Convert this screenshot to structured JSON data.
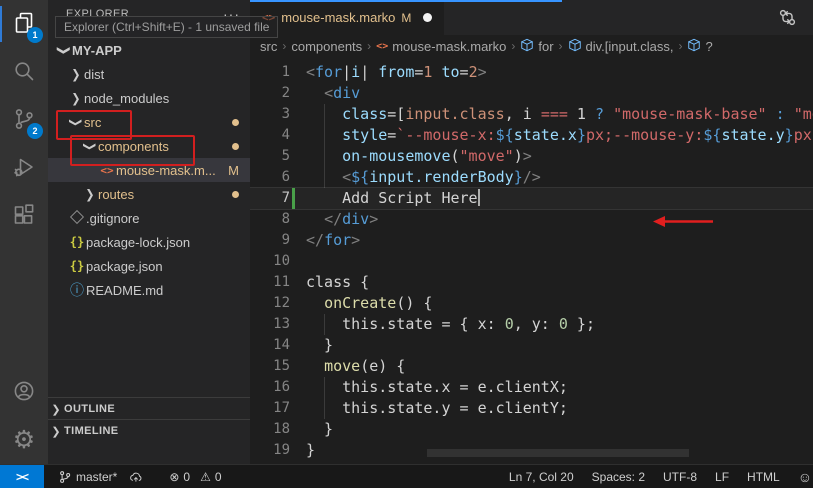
{
  "colors": {
    "accent_blue": "#007acc",
    "activity_badge_blue": "#007acc",
    "modified_tan": "#e2c08d",
    "marko_orange": "#e8744c",
    "annotation_red": "#d21f1f",
    "keyword_blue": "#569cd6",
    "variable_light_blue": "#9cdcfe",
    "string_red": "#d16969",
    "remote_blue": "#0078d4",
    "added_line_green": "#49a049"
  },
  "activity_bar": {
    "items": [
      {
        "name": "explorer",
        "icon": "files-icon",
        "badge": "1",
        "active": true
      },
      {
        "name": "search",
        "icon": "search-icon"
      },
      {
        "name": "source-control",
        "icon": "source-control-icon",
        "badge": "2"
      },
      {
        "name": "run-debug",
        "icon": "run-debug-icon"
      },
      {
        "name": "extensions",
        "icon": "extensions-icon"
      }
    ],
    "bottom_items": [
      {
        "name": "account",
        "icon": "account-icon"
      },
      {
        "name": "settings",
        "icon": "gear-icon"
      }
    ]
  },
  "sidebar": {
    "title": "EXPLORER",
    "more_actions": "···",
    "tooltip": "Explorer (Ctrl+Shift+E) - 1 unsaved file",
    "root_label": "MY-APP",
    "tree": [
      {
        "label": "dist",
        "kind": "folder",
        "expanded": false,
        "level": 1
      },
      {
        "label": "node_modules",
        "kind": "folder",
        "expanded": false,
        "level": 1
      },
      {
        "label": "src",
        "kind": "folder",
        "expanded": true,
        "level": 1,
        "modified": true,
        "dot": true,
        "annotated": true
      },
      {
        "label": "components",
        "kind": "folder",
        "expanded": true,
        "level": 2,
        "modified": true,
        "dot": true,
        "annotated": true
      },
      {
        "label": "mouse-mask.m...",
        "kind": "marko-file",
        "level": 3,
        "selected": true,
        "modified": true,
        "badge": "M"
      },
      {
        "label": "routes",
        "kind": "folder",
        "expanded": false,
        "level": 2,
        "modified": true,
        "dot": true
      },
      {
        "label": ".gitignore",
        "kind": "git-file",
        "level": 1
      },
      {
        "label": "package-lock.json",
        "kind": "json-file",
        "level": 1
      },
      {
        "label": "package.json",
        "kind": "json-file",
        "level": 1
      },
      {
        "label": "README.md",
        "kind": "info-file",
        "level": 1
      }
    ],
    "sections": [
      "OUTLINE",
      "TIMELINE"
    ]
  },
  "editor": {
    "tab": {
      "label": "mouse-mask.marko",
      "badge": "M",
      "dirty": true
    },
    "breadcrumbs": [
      {
        "label": "src"
      },
      {
        "label": "components"
      },
      {
        "label": "mouse-mask.marko",
        "icon": "marko"
      },
      {
        "label": "for",
        "icon": "symbol"
      },
      {
        "label": "div.[input.class,",
        "icon": "symbol"
      },
      {
        "label": "?",
        "icon": "symbol"
      }
    ],
    "cursor": {
      "line": 7,
      "col": 20
    },
    "annotation": {
      "arrow_line": 7,
      "boxes": [
        "src",
        "components"
      ]
    },
    "lines": [
      {
        "n": 1,
        "segs": [
          [
            "<",
            "p"
          ],
          [
            "for",
            "b"
          ],
          [
            "|",
            "w"
          ],
          [
            "i",
            "lb"
          ],
          [
            "|",
            "w"
          ],
          [
            " ",
            "w"
          ],
          [
            "from",
            "lb"
          ],
          [
            "=",
            "w"
          ],
          [
            "1",
            "t"
          ],
          [
            " ",
            "w"
          ],
          [
            "to",
            "lb"
          ],
          [
            "=",
            "w"
          ],
          [
            "2",
            "t"
          ],
          [
            ">",
            "p"
          ]
        ]
      },
      {
        "n": 2,
        "segs": [
          [
            "  ",
            "w"
          ],
          [
            "<",
            "p"
          ],
          [
            "div",
            "b"
          ]
        ]
      },
      {
        "n": 3,
        "g": [
          1
        ],
        "segs": [
          [
            "    ",
            "w"
          ],
          [
            "class",
            "lb"
          ],
          [
            "=[",
            "w"
          ],
          [
            "input.class",
            "t"
          ],
          [
            ", i ",
            "w"
          ],
          [
            "===",
            "s"
          ],
          [
            " 1 ",
            "w"
          ],
          [
            "?",
            "b"
          ],
          [
            " ",
            "w"
          ],
          [
            "\"mouse-mask-base\"",
            "s"
          ],
          [
            " ",
            "w"
          ],
          [
            ":",
            "b"
          ],
          [
            " ",
            "w"
          ],
          [
            "\"mou",
            "s"
          ]
        ]
      },
      {
        "n": 4,
        "g": [
          1
        ],
        "segs": [
          [
            "    ",
            "w"
          ],
          [
            "style",
            "lb"
          ],
          [
            "=",
            "w"
          ],
          [
            "`--mouse-x:",
            "s"
          ],
          [
            "${",
            "b"
          ],
          [
            "state.x",
            "lb"
          ],
          [
            "}",
            "b"
          ],
          [
            "px;--mouse-y:",
            "s"
          ],
          [
            "${",
            "b"
          ],
          [
            "state.y",
            "lb"
          ],
          [
            "}",
            "b"
          ],
          [
            "px;`",
            "s"
          ]
        ]
      },
      {
        "n": 5,
        "g": [
          1
        ],
        "segs": [
          [
            "    ",
            "w"
          ],
          [
            "on-mousemove",
            "lb"
          ],
          [
            "(",
            "w"
          ],
          [
            "\"move\"",
            "s"
          ],
          [
            ")",
            "w"
          ],
          [
            ">",
            "p"
          ]
        ]
      },
      {
        "n": 6,
        "g": [
          1
        ],
        "segs": [
          [
            "    ",
            "w"
          ],
          [
            "<",
            "p"
          ],
          [
            "${",
            "b"
          ],
          [
            "input.renderBody",
            "lb"
          ],
          [
            "}",
            "b"
          ],
          [
            "/>",
            "p"
          ]
        ]
      },
      {
        "n": 7,
        "cur": true,
        "added": true,
        "segs": [
          [
            "    Add Script Here",
            "w"
          ]
        ]
      },
      {
        "n": 8,
        "segs": [
          [
            "  ",
            "w"
          ],
          [
            "</",
            "p"
          ],
          [
            "div",
            "b"
          ],
          [
            ">",
            "p"
          ]
        ]
      },
      {
        "n": 9,
        "segs": [
          [
            "</",
            "p"
          ],
          [
            "for",
            "b"
          ],
          [
            ">",
            "p"
          ]
        ]
      },
      {
        "n": 10,
        "segs": []
      },
      {
        "n": 11,
        "segs": [
          [
            "class {",
            "w"
          ]
        ]
      },
      {
        "n": 12,
        "segs": [
          [
            "  ",
            "w"
          ],
          [
            "onCreate",
            "y"
          ],
          [
            "() {",
            "w"
          ]
        ]
      },
      {
        "n": 13,
        "g": [
          1
        ],
        "segs": [
          [
            "    this.state = { x: ",
            "w"
          ],
          [
            "0",
            "n"
          ],
          [
            ", y: ",
            "w"
          ],
          [
            "0",
            "n"
          ],
          [
            " };",
            "w"
          ]
        ]
      },
      {
        "n": 14,
        "segs": [
          [
            "  }",
            "w"
          ]
        ]
      },
      {
        "n": 15,
        "segs": [
          [
            "  ",
            "w"
          ],
          [
            "move",
            "y"
          ],
          [
            "(e) {",
            "w"
          ]
        ]
      },
      {
        "n": 16,
        "g": [
          1
        ],
        "segs": [
          [
            "    this.state.x = e.clientX;",
            "w"
          ]
        ]
      },
      {
        "n": 17,
        "g": [
          1
        ],
        "segs": [
          [
            "    this.state.y = e.clientY;",
            "w"
          ]
        ]
      },
      {
        "n": 18,
        "segs": [
          [
            "  }",
            "w"
          ]
        ]
      },
      {
        "n": 19,
        "segs": [
          [
            "}",
            "w"
          ]
        ]
      }
    ]
  },
  "status_bar": {
    "branch": "master*",
    "errors": "0",
    "warnings": "0",
    "error_glyph": "⊗",
    "warning_glyph": "⚠",
    "remote_glyph": "><",
    "right_items": [
      {
        "name": "line-col",
        "label": "Ln 7, Col 20"
      },
      {
        "name": "indentation",
        "label": "Spaces: 2"
      },
      {
        "name": "encoding",
        "label": "UTF-8"
      },
      {
        "name": "eol",
        "label": "LF"
      },
      {
        "name": "language-mode",
        "label": "HTML"
      }
    ],
    "feedback_glyph": "☺"
  }
}
